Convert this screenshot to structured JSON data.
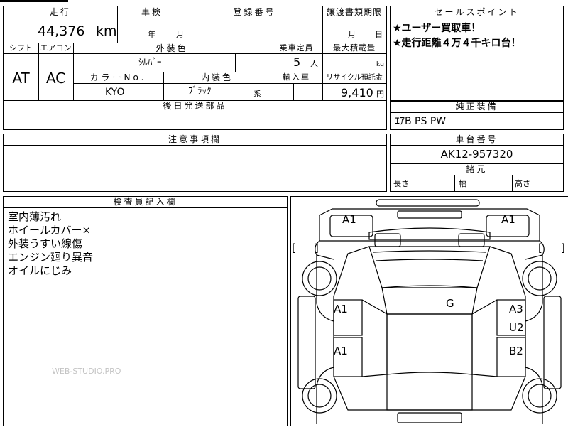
{
  "sheet": {
    "mileage": {
      "header": "走行",
      "value": "44,376",
      "unit": "km"
    },
    "inspection": {
      "header": "車検",
      "year_label": "年",
      "month_label": "月"
    },
    "registration_number": {
      "header": "登録番号",
      "value": ""
    },
    "transfer_document_deadline": {
      "header": "譲渡書類期限",
      "month_label": "月",
      "day_label": "日"
    },
    "shift": {
      "header": "シフト",
      "value": "AT"
    },
    "aircon": {
      "header": "エアコン",
      "value": "AC"
    },
    "exterior_color": {
      "header": "外装色",
      "value": "ｼﾙﾊﾞｰ"
    },
    "capacity": {
      "header": "乗車定員",
      "value": "5",
      "unit": "人"
    },
    "max_load": {
      "header": "最大積載量",
      "unit": "kg"
    },
    "color_no": {
      "header": "カラーNo.",
      "value": "KYO"
    },
    "interior_color": {
      "header": "内装色",
      "value": "ﾌﾞﾗｯｸ",
      "suffix": "系"
    },
    "import": {
      "header": "輸入車"
    },
    "recycle_deposit": {
      "header": "リサイクル預託金",
      "value": "9,410",
      "unit": "円"
    },
    "later_parts": {
      "header": "後日発送部品",
      "value": ""
    },
    "sales_points": {
      "header": "セールスポイント",
      "items": [
        "★ユーザー買取車！",
        "★走行距離４万４千キロ台！"
      ]
    },
    "genuine_equipment": {
      "header": "純正装備",
      "value": "ｴｱB PS PW"
    },
    "caution": {
      "header": "注意事項欄",
      "value": ""
    },
    "chassis_number": {
      "header": "車台番号",
      "value": "AK12-957320"
    },
    "dimensions": {
      "header": "諸元",
      "length": "長さ",
      "width": "幅",
      "height": "高さ"
    },
    "inspector_notes": {
      "header": "検査員記入欄",
      "lines": [
        "室内薄汚れ",
        "ホイールカバー×",
        "外装うすい線傷",
        "エンジン廻り異音",
        "オイルにじみ"
      ]
    },
    "watermark": "WEB-STUDIO.PRO"
  },
  "diagram": {
    "marks": {
      "front_left": "A1",
      "front_right": "A1",
      "roof": "G",
      "left_front_door": "A1",
      "left_rear_door": "A1",
      "right_front_door_1": "A3",
      "right_front_door_2": "U2",
      "right_rear_door": "B2"
    },
    "bracket_open": "[",
    "bracket_close": "]"
  }
}
